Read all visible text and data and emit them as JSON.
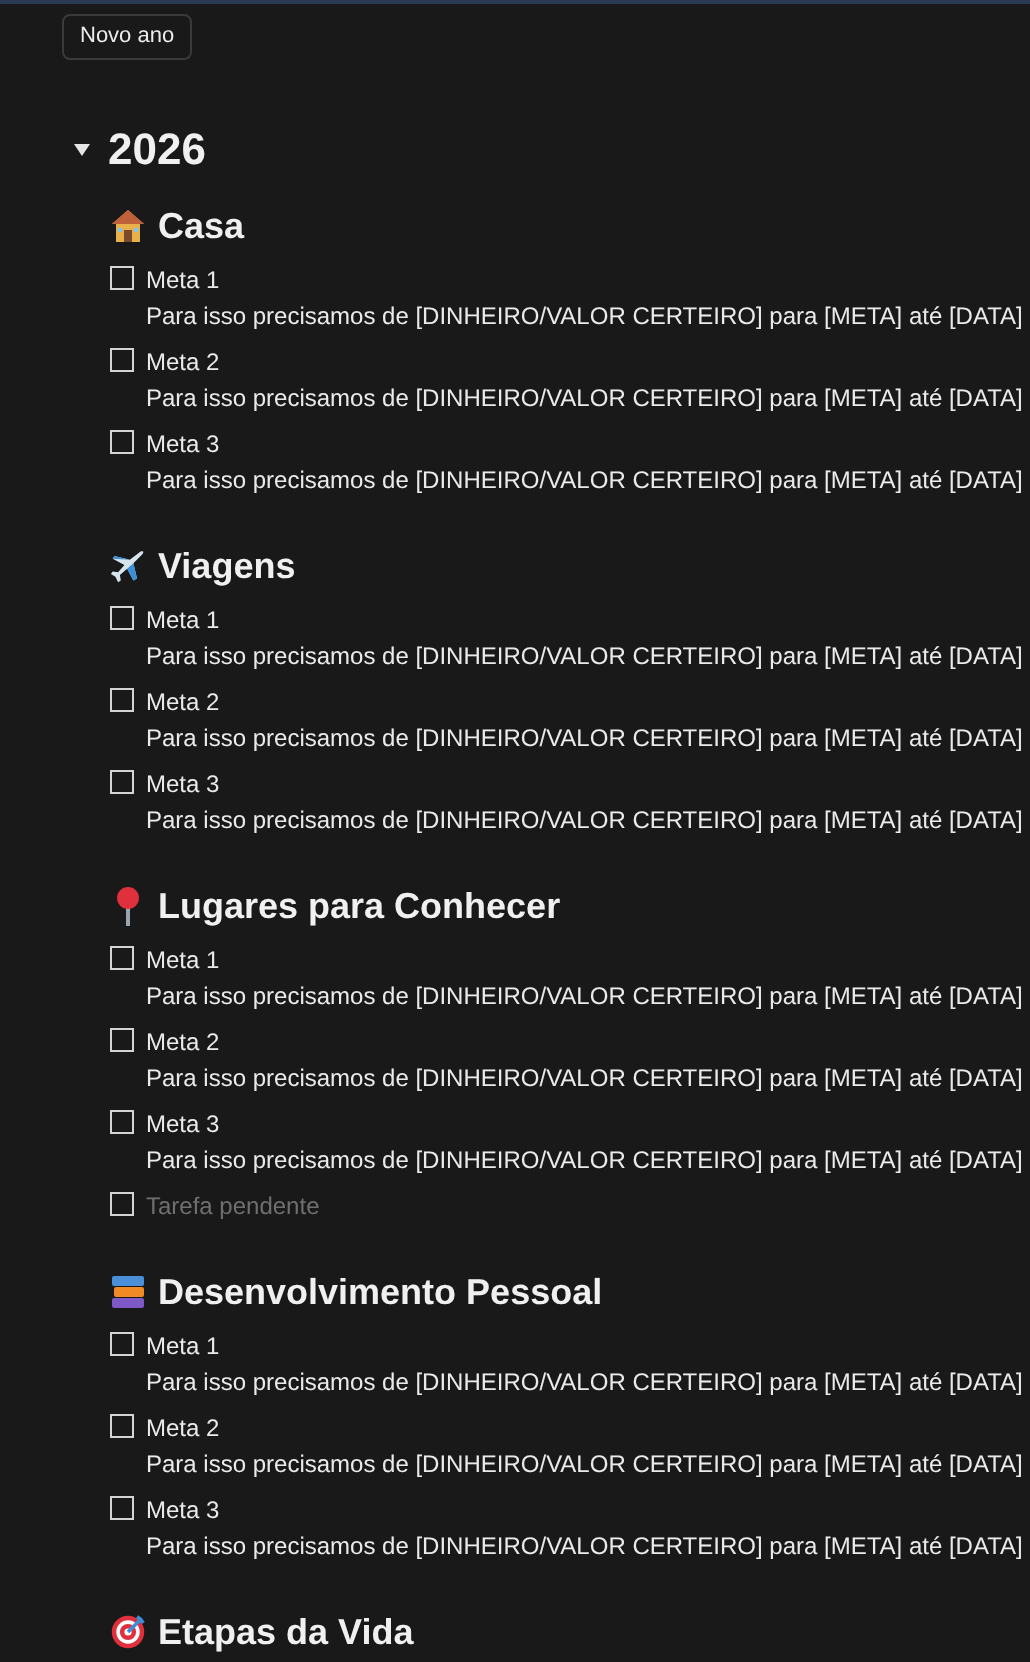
{
  "new_button": "Novo ano",
  "year": {
    "title": "2026",
    "expanded": true
  },
  "sections": [
    {
      "title": "Casa",
      "items": [
        {
          "kind": "goal",
          "title": "Meta 1",
          "description": "Para isso precisamos de [DINHEIRO/VALOR CERTEIRO] para [META] até [DATA]",
          "checked": false
        },
        {
          "kind": "goal",
          "title": "Meta 2",
          "description": "Para isso precisamos de [DINHEIRO/VALOR CERTEIRO] para [META] até [DATA]",
          "checked": false
        },
        {
          "kind": "goal",
          "title": "Meta 3",
          "description": "Para isso precisamos de [DINHEIRO/VALOR CERTEIRO] para [META] até [DATA]",
          "checked": false
        }
      ]
    },
    {
      "title": "Viagens",
      "items": [
        {
          "kind": "goal",
          "title": "Meta 1",
          "description": "Para isso precisamos de [DINHEIRO/VALOR CERTEIRO] para [META] até [DATA]",
          "checked": false
        },
        {
          "kind": "goal",
          "title": "Meta 2",
          "description": "Para isso precisamos de [DINHEIRO/VALOR CERTEIRO] para [META] até [DATA]",
          "checked": false
        },
        {
          "kind": "goal",
          "title": "Meta 3",
          "description": "Para isso precisamos de [DINHEIRO/VALOR CERTEIRO] para [META] até [DATA]",
          "checked": false
        }
      ]
    },
    {
      "title": "Lugares para Conhecer",
      "items": [
        {
          "kind": "goal",
          "title": "Meta 1",
          "description": "Para isso precisamos de [DINHEIRO/VALOR CERTEIRO] para [META] até [DATA]",
          "checked": false
        },
        {
          "kind": "goal",
          "title": "Meta 2",
          "description": "Para isso precisamos de [DINHEIRO/VALOR CERTEIRO] para [META] até [DATA]",
          "checked": false
        },
        {
          "kind": "goal",
          "title": "Meta 3",
          "description": "Para isso precisamos de [DINHEIRO/VALOR CERTEIRO] para [META] até [DATA]",
          "checked": false
        },
        {
          "kind": "placeholder",
          "title": "Tarefa pendente",
          "checked": false
        }
      ]
    },
    {
      "title": "Desenvolvimento Pessoal",
      "items": [
        {
          "kind": "goal",
          "title": "Meta 1",
          "description": "Para isso precisamos de [DINHEIRO/VALOR CERTEIRO] para [META] até [DATA]",
          "checked": false
        },
        {
          "kind": "goal",
          "title": "Meta 2",
          "description": "Para isso precisamos de [DINHEIRO/VALOR CERTEIRO] para [META] até [DATA]",
          "checked": false
        },
        {
          "kind": "goal",
          "title": "Meta 3",
          "description": "Para isso precisamos de [DINHEIRO/VALOR CERTEIRO] para [META] até [DATA]",
          "checked": false
        }
      ]
    },
    {
      "title": "Etapas da Vida"
    }
  ]
}
